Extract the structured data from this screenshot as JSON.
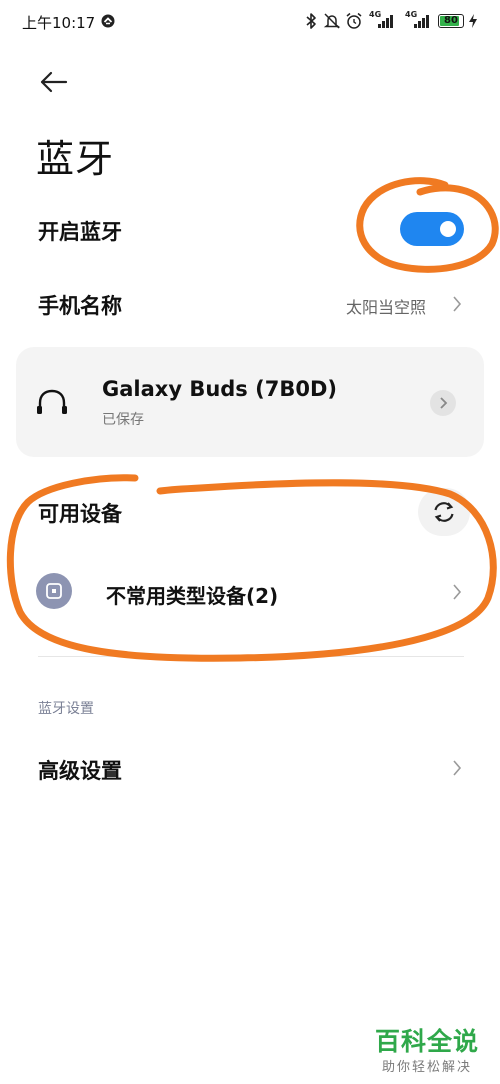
{
  "status_bar": {
    "time": "上午10:17",
    "icons": [
      "app-badge-icon",
      "bluetooth-icon",
      "mute-icon",
      "alarm-icon",
      "signal-4g-1-icon",
      "signal-4g-2-icon",
      "battery-icon",
      "charging-icon"
    ],
    "signal_label": "4G",
    "battery_level": "80"
  },
  "header": {
    "title": "蓝牙"
  },
  "bluetooth_toggle": {
    "label": "开启蓝牙",
    "state": "on",
    "accent_color": "#1f86f0"
  },
  "device_name_row": {
    "label": "手机名称",
    "value": "太阳当空照"
  },
  "saved_device": {
    "name": "Galaxy Buds (7B0D)",
    "status": "已保存",
    "icon": "headphones-icon"
  },
  "available_devices": {
    "label": "可用设备",
    "refresh_icon": "refresh-icon",
    "items": [
      {
        "label": "不常用类型设备(2)",
        "icon": "device-type-icon"
      }
    ]
  },
  "settings_section": {
    "label": "蓝牙设置",
    "items": [
      {
        "label": "高级设置"
      }
    ]
  },
  "annotation_color": "#f07a22",
  "watermark": {
    "main": "百科全说",
    "sub": "助你轻松解决"
  }
}
